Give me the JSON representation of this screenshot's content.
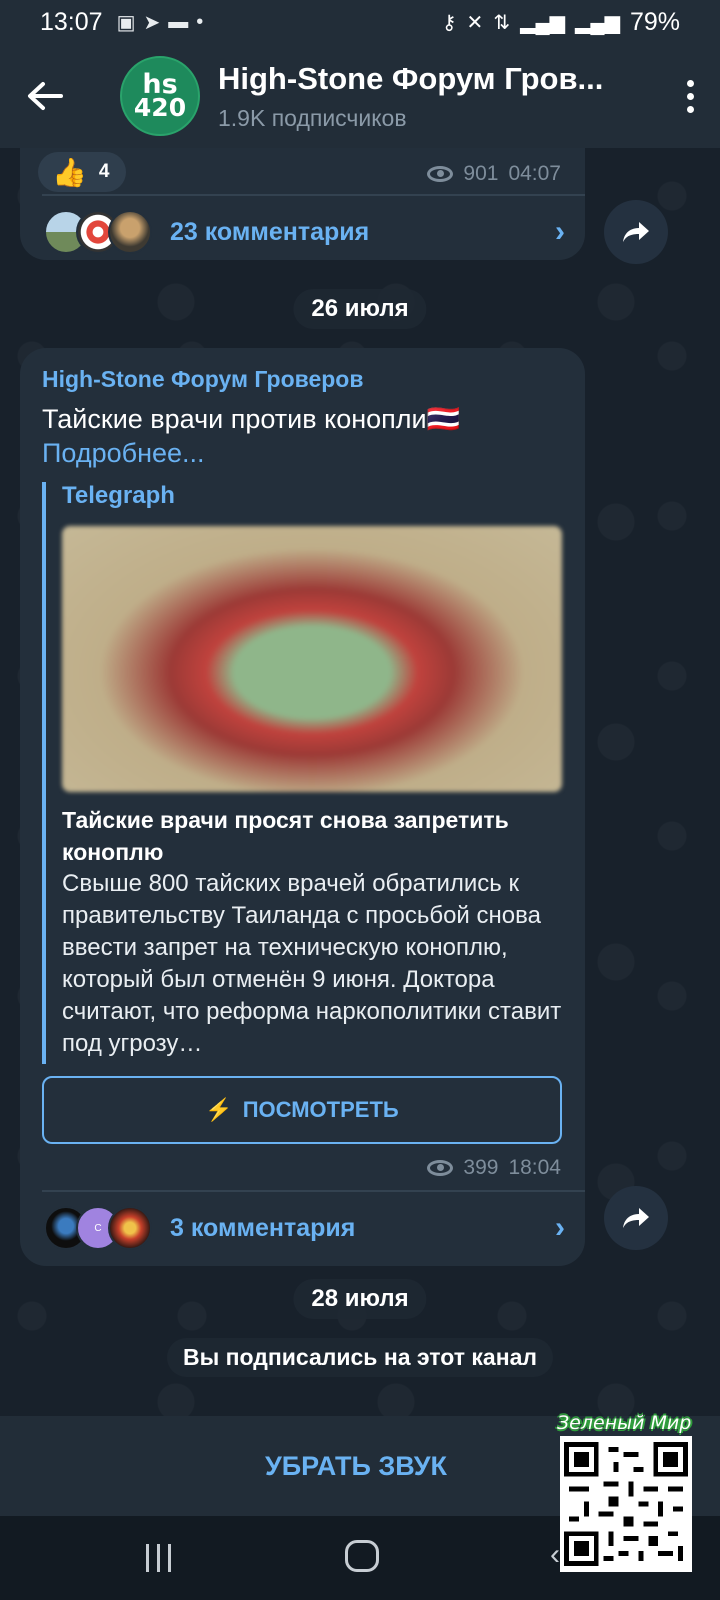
{
  "status_bar": {
    "time": "13:07",
    "battery": "79%",
    "icons": [
      "image-icon",
      "telegram-icon",
      "chat-icon",
      "dot-icon",
      "key-icon",
      "mute-vibrate-icon",
      "data-icon",
      "signal-icon",
      "signal-icon-2"
    ]
  },
  "header": {
    "avatar_line1": "hs",
    "avatar_line2": "420",
    "title": "High-Stone Форум Гров...",
    "subtitle": "1.9K подписчиков"
  },
  "messages": [
    {
      "reaction_emoji": "👍",
      "reaction_count": "4",
      "views": "901",
      "time": "04:07",
      "comments_label": "23 комментария"
    },
    {
      "sender": "High-Stone Форум Гроверов",
      "text": "Тайские врачи против конопли🇹🇭",
      "more_link": "Подробнее...",
      "preview": {
        "site": "Telegraph",
        "title": "Тайские врачи просят снова запретить коноплю",
        "description": "Свыше 800 тайских врачей обратились к правительству Таиланда с просьбой снова ввести запрет на техническую коноплю, который был отменён 9 июня. Доктора считают, что реформа наркополитики ставит под угрозу…"
      },
      "view_button": "ПОСМОТРЕТЬ",
      "views": "399",
      "time": "18:04",
      "comments_label": "3 комментария",
      "comment_avatar_letter": "C"
    }
  ],
  "dates": {
    "first": "26 июля",
    "second": "28 июля"
  },
  "service_message": "Вы подписались на этот канал",
  "bottom_bar": {
    "mute_label": "УБРАТЬ ЗВУК"
  },
  "watermark_text": "Зеленый Мир",
  "colors": {
    "accent": "#6ab2f2",
    "bubble": "#232f3b",
    "header": "#222d38",
    "background": "#18212b"
  }
}
